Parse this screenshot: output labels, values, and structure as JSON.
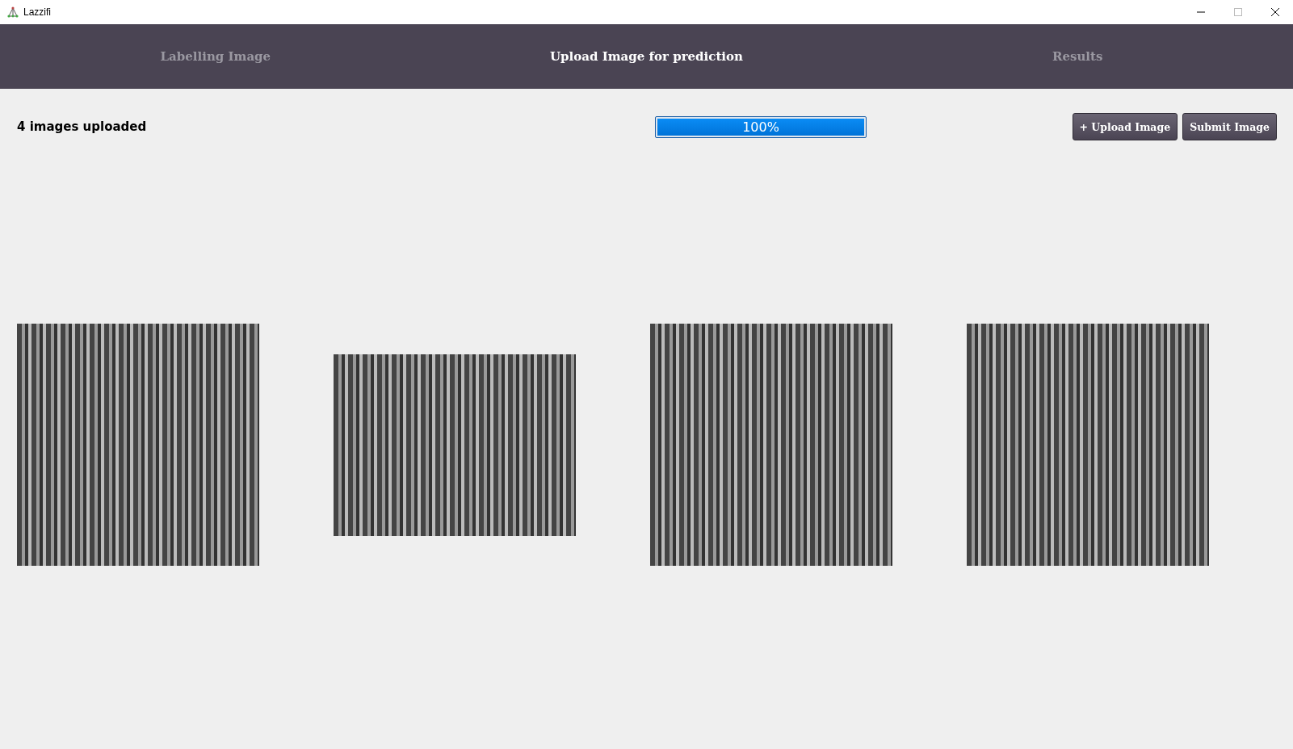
{
  "window": {
    "title": "Lazzifi"
  },
  "tabs": [
    {
      "label": "Labelling Image",
      "selected": false
    },
    {
      "label": "Upload Image for prediction",
      "selected": true
    },
    {
      "label": "Results",
      "selected": false
    }
  ],
  "toolbar": {
    "status": "4 images uploaded",
    "progress": {
      "level": 1,
      "reading": "100%"
    },
    "buttons": [
      "+ Upload Image",
      "Submit Image"
    ]
  },
  "images": [
    {
      "kind": "square"
    },
    {
      "kind": "landscape"
    },
    {
      "kind": "square"
    },
    {
      "kind": "square"
    }
  ]
}
